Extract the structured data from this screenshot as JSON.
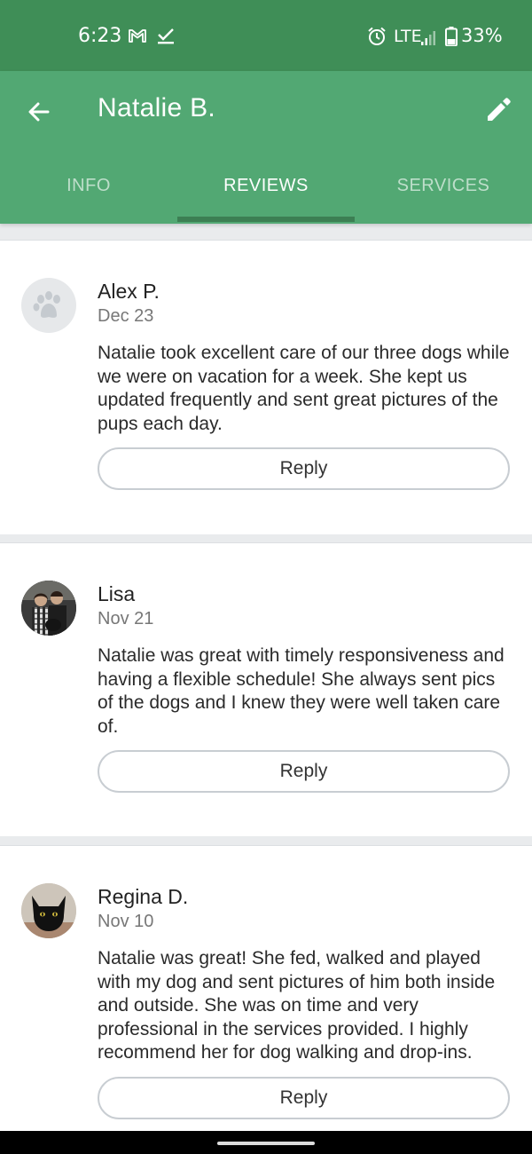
{
  "status_bar": {
    "time": "6:23",
    "network": "LTE",
    "battery": "33%"
  },
  "header": {
    "title": "Natalie B."
  },
  "tabs": [
    {
      "label": "INFO",
      "active": false
    },
    {
      "label": "REVIEWS",
      "active": true
    },
    {
      "label": "SERVICES",
      "active": false
    }
  ],
  "reviews": [
    {
      "name": "Alex P.",
      "date": "Dec 23",
      "avatar": "paw-placeholder-icon",
      "text": "Natalie took excellent care of our three dogs while we were on vacation for a week. She kept us updated frequently and sent great pictures of the pups each day.",
      "reply_label": "Reply"
    },
    {
      "name": "Lisa",
      "date": "Nov 21",
      "avatar": "photo-couple-with-dog",
      "text": "Natalie was great with timely responsiveness and having a flexible schedule! She always sent pics of the dogs and I knew they were well taken care of.",
      "reply_label": "Reply"
    },
    {
      "name": "Regina D.",
      "date": "Nov 10",
      "avatar": "photo-black-cat",
      "text": "Natalie was great!  She fed, walked and played with my dog and sent pictures of him both inside and outside.  She was on time and very professional in the services provided.  I highly recommend her for dog walking and drop-ins.",
      "reply_label": "Reply"
    }
  ],
  "colors": {
    "status_bar": "#3f8e57",
    "app_bar": "#52a873",
    "tab_indicator": "#3c7f53"
  }
}
